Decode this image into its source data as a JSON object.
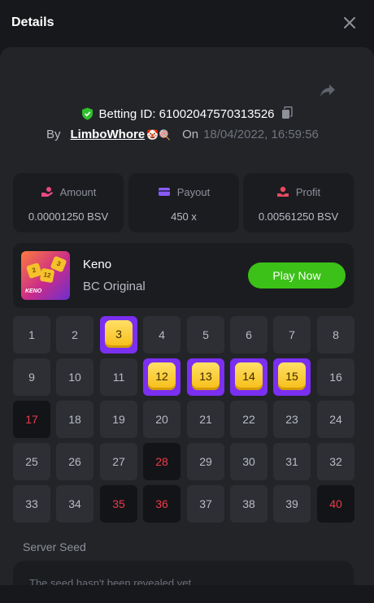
{
  "header": {
    "title": "Details"
  },
  "bet": {
    "label": "Betting ID: 61002047570313526",
    "by_label": "By",
    "user": "LimboWhore",
    "user_emoji": "🤡🍭",
    "on_label": "On",
    "date": "18/04/2022, 16:59:56"
  },
  "stats": {
    "amount": {
      "label": "Amount",
      "value": "0.00001250 BSV",
      "color": "#e84a7f"
    },
    "payout": {
      "label": "Payout",
      "value": "450 x",
      "color": "#8a5cf6"
    },
    "profit": {
      "label": "Profit",
      "value": "0.00561250 BSV",
      "color": "#e84a5f"
    }
  },
  "game": {
    "name": "Keno",
    "provider": "BC Original",
    "play_label": "Play Now",
    "thumb_label": "KENO",
    "thumb_tiles": [
      "2",
      "12",
      "3"
    ]
  },
  "keno": {
    "numbers": [
      "1",
      "2",
      "3",
      "4",
      "5",
      "6",
      "7",
      "8",
      "9",
      "10",
      "11",
      "12",
      "13",
      "14",
      "15",
      "16",
      "17",
      "18",
      "19",
      "20",
      "21",
      "22",
      "23",
      "24",
      "25",
      "26",
      "27",
      "28",
      "29",
      "30",
      "31",
      "32",
      "33",
      "34",
      "35",
      "36",
      "37",
      "38",
      "39",
      "40"
    ],
    "selected_hits": [
      "3",
      "12",
      "13",
      "14",
      "15"
    ],
    "drawn_misses": [
      "17",
      "28",
      "35",
      "36",
      "40"
    ]
  },
  "seed": {
    "label": "Server Seed",
    "text": "The seed hasn't been revealed yet"
  },
  "colors": {
    "accent_green": "#3bc117",
    "purple": "#7b2ff0",
    "gem": "#f6bd16",
    "miss_red": "#ed3b4c"
  },
  "icons": [
    "close-icon",
    "share-icon",
    "shield-icon",
    "copy-icon",
    "amount-icon",
    "payout-icon",
    "profit-icon"
  ]
}
